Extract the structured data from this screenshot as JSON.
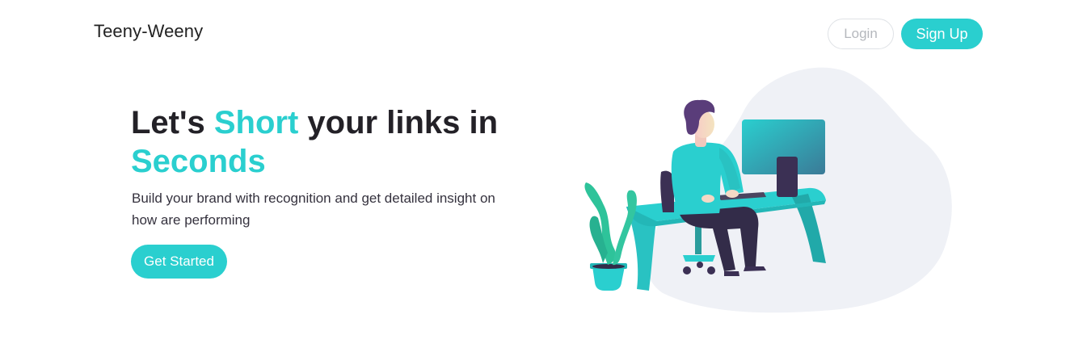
{
  "header": {
    "brand": "Teeny-Weeny",
    "login_label": "Login",
    "signup_label": "Sign Up"
  },
  "hero": {
    "title_part1": "Let's ",
    "title_accent1": "Short",
    "title_part2": " your links in ",
    "title_accent2": "Seconds",
    "description": "Build your brand with recognition and get detailed insight on how are performing",
    "cta_label": "Get Started"
  },
  "colors": {
    "accent": "#2acfcf",
    "text_dark": "#232127",
    "blob": "#eff1f6"
  },
  "illustration": {
    "icon": "person-working-at-desk-illustration"
  }
}
